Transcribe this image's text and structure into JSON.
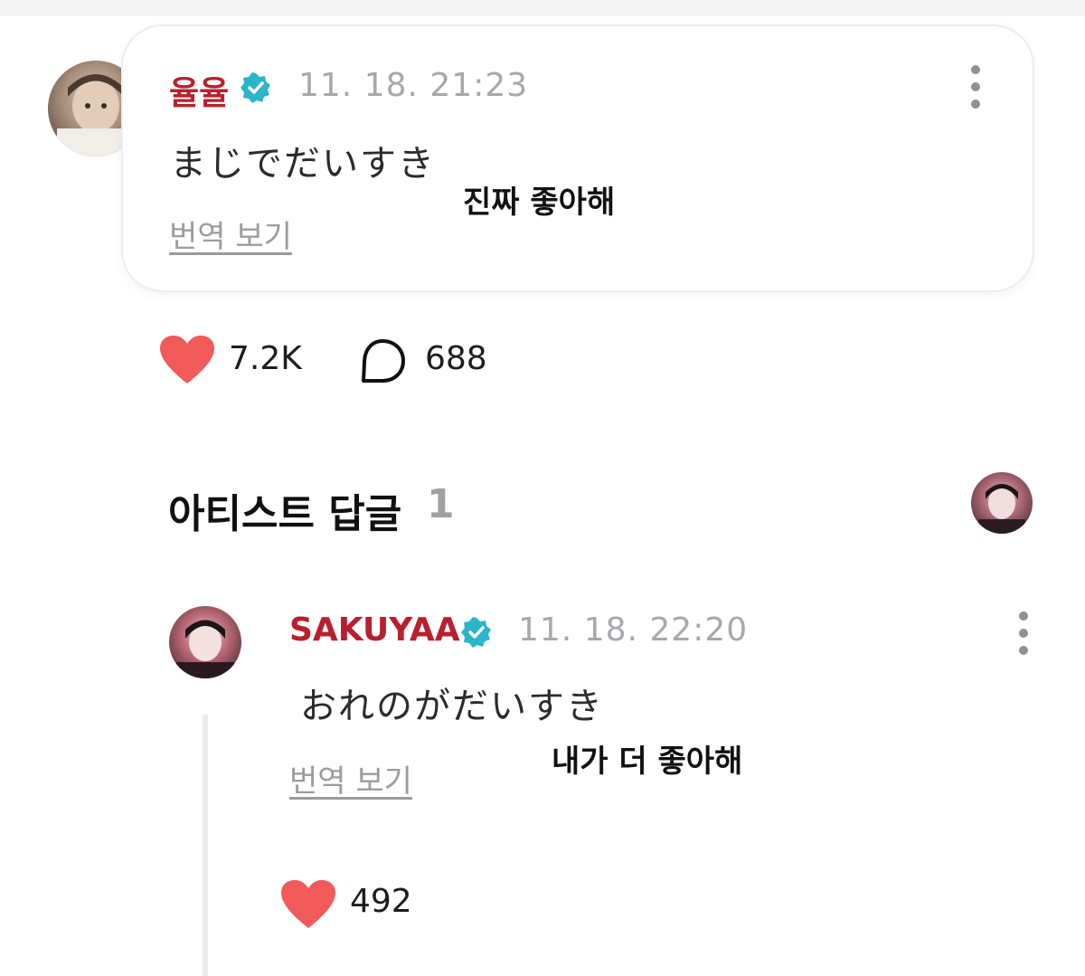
{
  "post": {
    "author": "율율",
    "timestamp": "11. 18. 21:23",
    "body": "まじでだいすき",
    "translate_label": "번역 보기",
    "overlay_translation": "진짜 좋아해",
    "likes": "7.2K",
    "comments": "688"
  },
  "artist_replies": {
    "title": "아티스트 답글",
    "count": "1"
  },
  "reply": {
    "author": "SAKUYAA",
    "timestamp": "11. 18. 22:20",
    "body": "おれのがだいすき",
    "translate_label": "번역 보기",
    "overlay_translation": "내가 더 좋아해",
    "likes": "492"
  },
  "colors": {
    "author_red": "#b8202e",
    "verified_teal": "#2bb5c9",
    "heart_red": "#f25a5a",
    "muted_gray": "#a7a7ad"
  },
  "icons": {
    "verified": "verified-badge-icon",
    "more": "more-vertical-icon",
    "like": "heart-icon",
    "comment": "comment-bubble-icon"
  }
}
